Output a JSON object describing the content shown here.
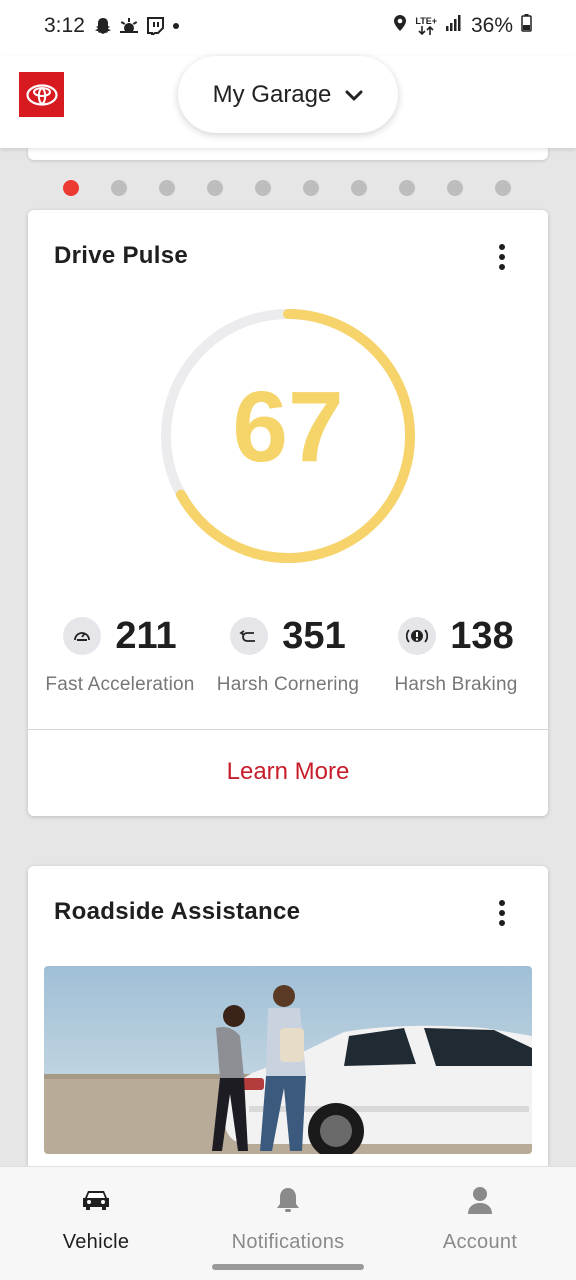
{
  "status_bar": {
    "time": "3:12",
    "network": "LTE+",
    "battery": "36%",
    "left_icons": [
      "snapchat-icon",
      "weather-icon",
      "twitch-icon",
      "dot-icon"
    ],
    "right_icons": [
      "location-icon",
      "lte-icon",
      "signal-icon",
      "battery-icon"
    ]
  },
  "header": {
    "logo_icon": "toyota-logo",
    "garage_label": "My Garage",
    "garage_chevron_icon": "chevron-down-icon"
  },
  "pager": {
    "total": 10,
    "active_index": 0
  },
  "drive_pulse": {
    "title": "Drive Pulse",
    "score": "67",
    "score_fraction": 0.67,
    "gauge_color": "#f7d46b",
    "track_color": "#ececee",
    "metrics": [
      {
        "icon": "fast-acceleration-icon",
        "value": "211",
        "label": "Fast Acceleration"
      },
      {
        "icon": "harsh-cornering-icon",
        "value": "351",
        "label": "Harsh Cornering"
      },
      {
        "icon": "harsh-braking-icon",
        "value": "138",
        "label": "Harsh Braking"
      }
    ],
    "action_label": "Learn More"
  },
  "roadside": {
    "title": "Roadside Assistance"
  },
  "bottom_nav": {
    "items": [
      {
        "icon": "car-icon",
        "label": "Vehicle",
        "active": true
      },
      {
        "icon": "bell-icon",
        "label": "Notifications",
        "active": false
      },
      {
        "icon": "person-icon",
        "label": "Account",
        "active": false
      }
    ]
  },
  "colors": {
    "brand_red": "#d71920",
    "accent_red": "#c81e2b",
    "pager_active": "#eb3a32",
    "pager_inactive": "#bdbdbd"
  }
}
